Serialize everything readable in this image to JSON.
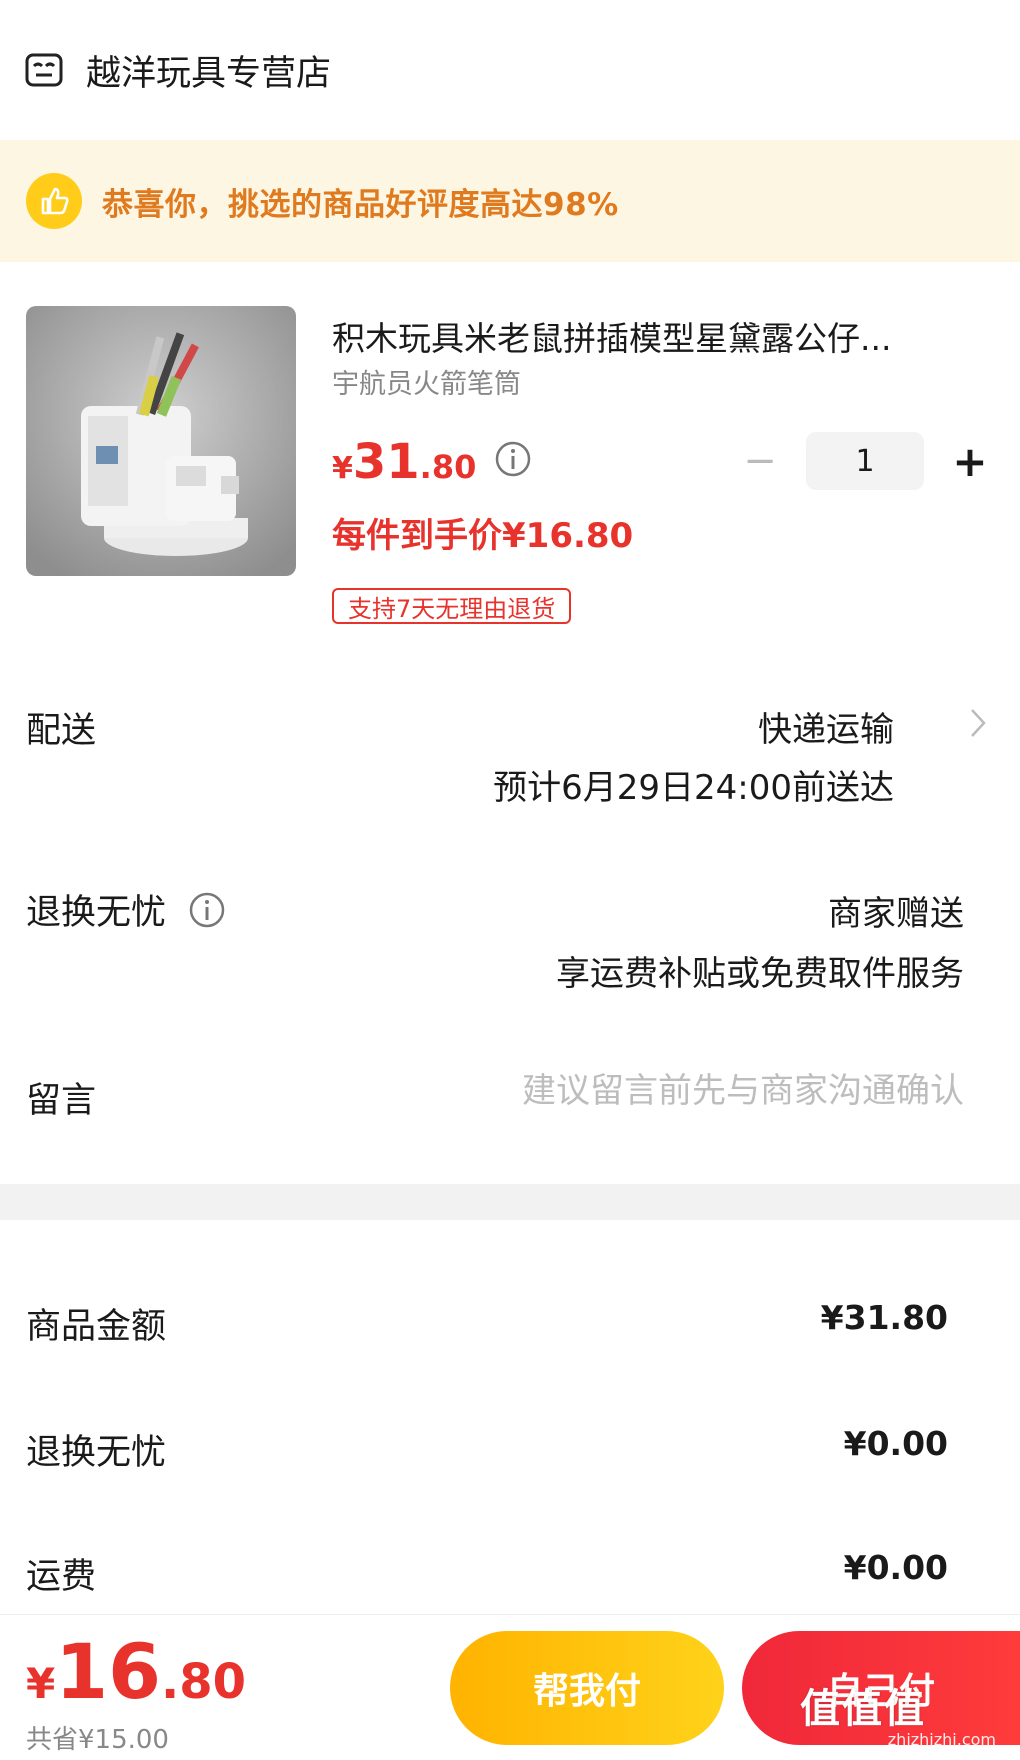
{
  "store": {
    "name": "越洋玩具专营店",
    "icon": "store-icon"
  },
  "banner": {
    "text": "恭喜你，挑选的商品好评度高达98%",
    "icon": "thumbs-up-icon",
    "accent": "#e07a1f"
  },
  "product": {
    "title": "积木玩具米老鼠拼插模型星黛露公仔...",
    "sku": "宇航员火箭笔筒",
    "price": {
      "currency": "¥",
      "integer": "31",
      "decimal": ".80"
    },
    "unit_price": "每件到手价¥16.80",
    "return_tag": "支持7天无理由退货",
    "quantity": "1",
    "minus": "−",
    "plus": "+"
  },
  "delivery": {
    "label": "配送",
    "method": "快递运输",
    "eta": "预计6月29日24:00前送达"
  },
  "return_worry": {
    "label": "退换无忧",
    "value1": "商家赠送",
    "value2": "享运费补贴或免费取件服务"
  },
  "note": {
    "label": "留言",
    "placeholder": "建议留言前先与商家沟通确认"
  },
  "summary": [
    {
      "label": "商品金额",
      "value": "¥31.80"
    },
    {
      "label": "退换无忧",
      "value": "¥0.00"
    },
    {
      "label": "运费",
      "value": "¥0.00"
    }
  ],
  "bottom": {
    "total": {
      "currency": "¥",
      "integer": "16",
      "decimal": ".80"
    },
    "saved": "共省¥15.00",
    "help_pay": "帮我付",
    "self_pay": "自己付"
  },
  "watermark": {
    "logo": "值值值",
    "url": "zhizhizhi.com"
  },
  "colors": {
    "price_red": "#e8322c",
    "banner_bg": "#fdf6e3",
    "yellow": "#ffcc1a"
  }
}
